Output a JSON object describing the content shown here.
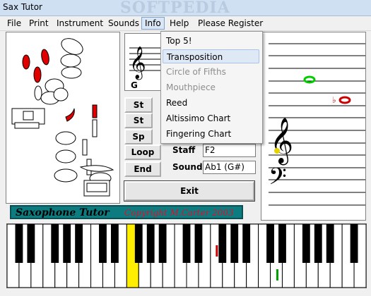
{
  "window": {
    "title": "Sax Tutor",
    "watermark": "SOFTPEDIA"
  },
  "menu": [
    "File",
    "Print",
    "Instrument",
    "Sounds",
    "Info",
    "Help",
    "Please Register"
  ],
  "info_menu": {
    "items": [
      {
        "label": "Top 5!",
        "enabled": true
      },
      {
        "label": "Transposition",
        "enabled": true,
        "highlighted": true
      },
      {
        "label": "Circle of Fifths",
        "enabled": false
      },
      {
        "label": "Mouthpiece",
        "enabled": false
      },
      {
        "label": "Reed",
        "enabled": true
      },
      {
        "label": "Altissimo Chart",
        "enabled": true
      },
      {
        "label": "Fingering Chart",
        "enabled": true
      }
    ]
  },
  "buttons": {
    "st1": "St",
    "st2": "St",
    "sp": "Sp",
    "loop": "Loop",
    "end": "End",
    "exit": "Exit"
  },
  "clef_partial": "G",
  "fields": {
    "staff": {
      "label": "Staff",
      "value": "F2"
    },
    "sound": {
      "label": "Sound",
      "value": "Ab1 (G#)"
    }
  },
  "banner": {
    "title": "Saxophone Tutor",
    "copyright": "Copyright M.Carter 2003"
  },
  "colors": {
    "accent_key": "#ffee00",
    "key_marker_red": "#d00000",
    "key_marker_green": "#00a000",
    "note_green": "#00cc00",
    "note_red": "#cc0000",
    "banner_bg": "#0d7c80"
  }
}
